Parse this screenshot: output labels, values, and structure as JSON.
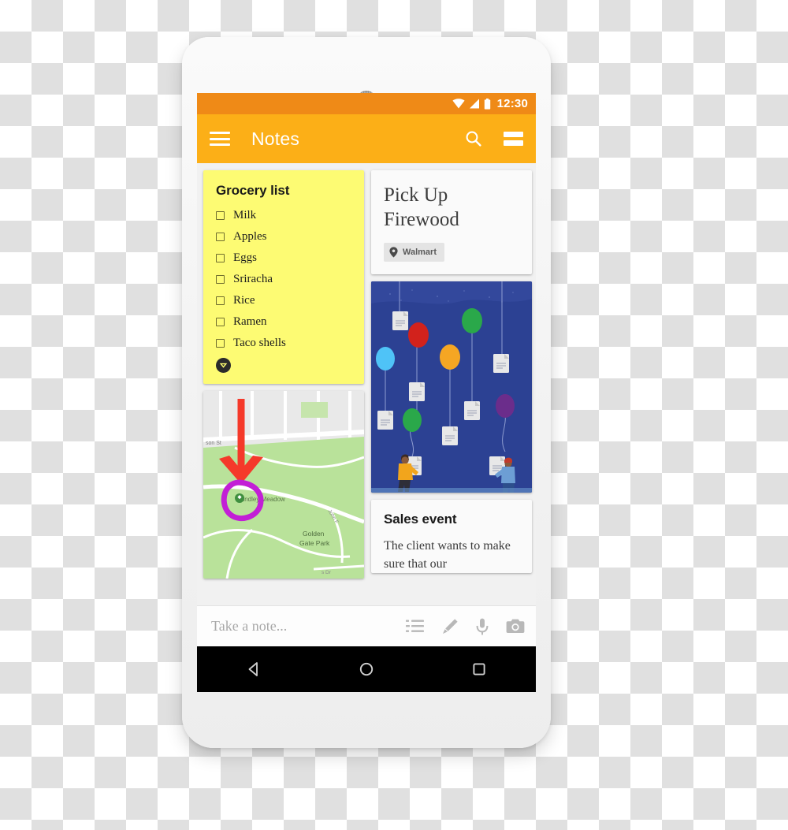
{
  "device": {
    "name": "android-phone-mockup"
  },
  "status_bar": {
    "time": "12:30",
    "icons": [
      "wifi-icon",
      "cell-signal-icon",
      "battery-icon"
    ],
    "bg_color": "#ef8a17"
  },
  "app_bar": {
    "title": "Notes",
    "menu_icon": "hamburger-menu-icon",
    "search_icon": "search-icon",
    "view_toggle_icon": "list-view-toggle-icon",
    "bg_color": "#fcaf17",
    "text_color": "#ffffff"
  },
  "notes": {
    "grocery": {
      "title": "Grocery list",
      "bg_color": "#fdfb73",
      "items": [
        {
          "label": "Milk",
          "checked": false
        },
        {
          "label": "Apples",
          "checked": false
        },
        {
          "label": "Eggs",
          "checked": false
        },
        {
          "label": "Sriracha",
          "checked": false
        },
        {
          "label": "Rice",
          "checked": false
        },
        {
          "label": "Ramen",
          "checked": false
        },
        {
          "label": "Taco shells",
          "checked": false
        }
      ],
      "footer_icon": "collapse-badge-icon"
    },
    "firewood": {
      "title": "Pick Up Firewood",
      "chip_label": "Walmart",
      "chip_icon": "location-pin-icon",
      "bg_color": "#fafafa"
    },
    "balloons": {
      "bg_color": "#2c4193",
      "alt": "illustration-balloons-carrying-notes",
      "balloon_colors": [
        "#e02b20",
        "#2aa84a",
        "#4fc3f7",
        "#f5a623",
        "#2aa84a",
        "#6b2d8b"
      ],
      "figure_count": 2
    },
    "sales": {
      "title": "Sales event",
      "body": "The client wants to make sure that our",
      "bg_color": "#fafafa"
    },
    "map": {
      "alt": "map-note-with-drawing-annotation",
      "labels": [
        "Lindley Meadow",
        "Golden Gate Park",
        "son St"
      ],
      "annotation_arrow_color": "#f5392a",
      "annotation_circle_color": "#c21fd6",
      "park_color": "#b9e29a",
      "road_color": "#ffffff"
    }
  },
  "take_note_bar": {
    "placeholder": "Take a note...",
    "actions": [
      "checklist-icon",
      "brush-icon",
      "microphone-icon",
      "camera-icon"
    ]
  },
  "nav_bar": {
    "back_icon": "back-triangle-icon",
    "home_icon": "home-circle-icon",
    "recents_icon": "recents-square-icon",
    "bg_color": "#000000"
  }
}
